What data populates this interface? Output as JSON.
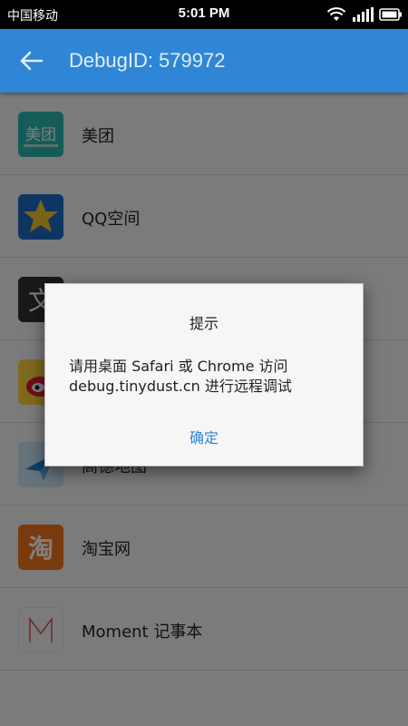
{
  "status_bar": {
    "carrier": "中国移动",
    "time": "5:01 PM"
  },
  "app_bar": {
    "title": "DebugID: 579972"
  },
  "apps": [
    {
      "name": "美团",
      "icon": "meituan-icon",
      "icon_text": "美团"
    },
    {
      "name": "QQ空间",
      "icon": "qzone-icon",
      "icon_text": ""
    },
    {
      "name": "",
      "icon": "wenzi-icon",
      "icon_text": "文"
    },
    {
      "name": "",
      "icon": "weibo-icon",
      "icon_text": ""
    },
    {
      "name": "高德地图",
      "icon": "gaode-map-icon",
      "icon_text": ""
    },
    {
      "name": "淘宝网",
      "icon": "taobao-icon",
      "icon_text": "淘"
    },
    {
      "name": "Moment 记事本",
      "icon": "moment-icon",
      "icon_text": "M"
    }
  ],
  "dialog": {
    "title": "提示",
    "message_line1": "请用桌面 Safari 或 Chrome 访问",
    "message_line2": "debug.tinydust.cn 进行远程调试",
    "confirm_label": "确定"
  },
  "colors": {
    "app_bar": "#2f86d6",
    "accent": "#2f86d6",
    "status_bar": "#000000"
  }
}
